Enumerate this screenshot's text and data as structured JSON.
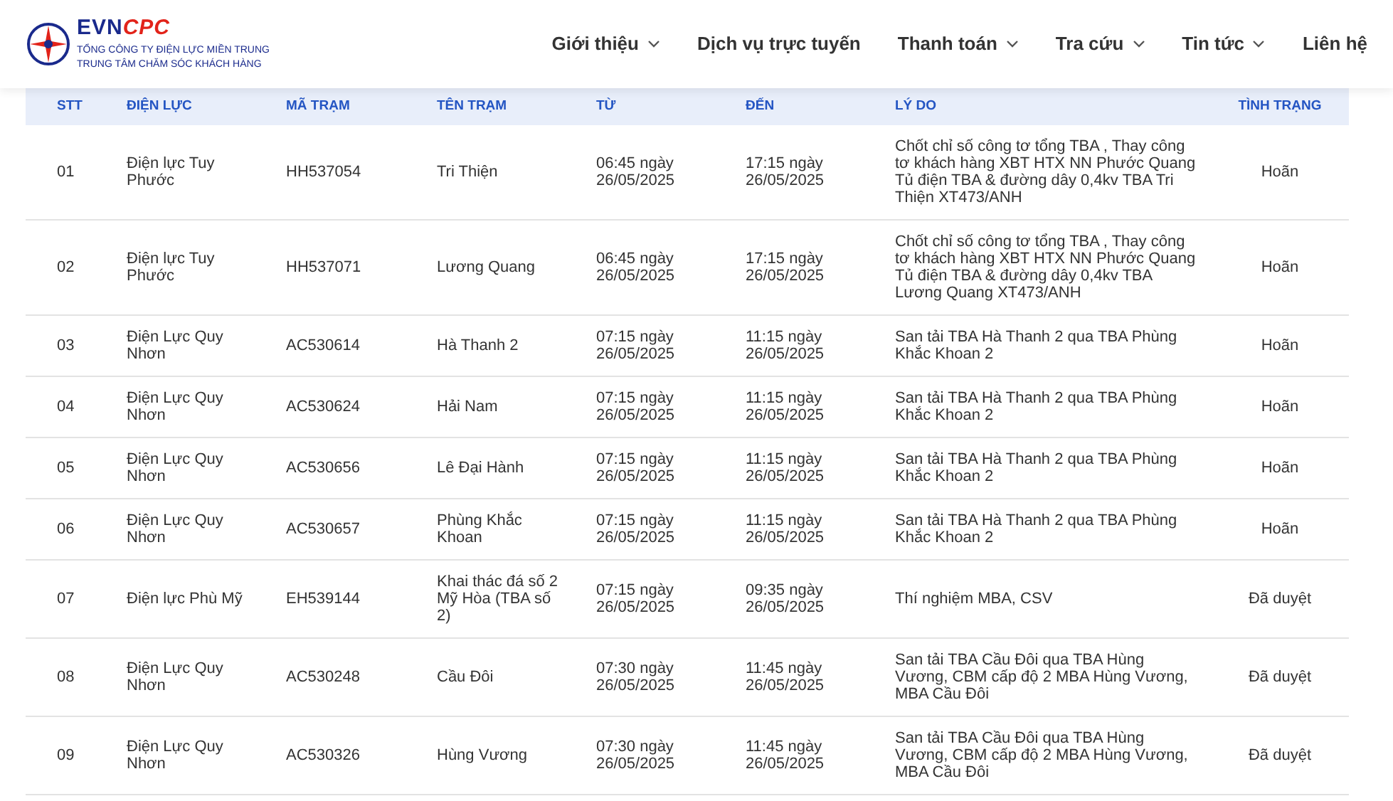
{
  "header": {
    "logo": {
      "brand": "EVN",
      "brand_accent": "CPC",
      "subtitle": [
        "TỔNG CÔNG TY ĐIỆN LỰC MIỀN TRUNG",
        "TRUNG TÂM CHĂM SÓC KHÁCH HÀNG"
      ]
    },
    "nav": [
      {
        "label": "Giới thiệu",
        "dropdown": true
      },
      {
        "label": "Dịch vụ trực tuyến",
        "dropdown": false
      },
      {
        "label": "Thanh toán",
        "dropdown": true
      },
      {
        "label": "Tra cứu",
        "dropdown": true
      },
      {
        "label": "Tin tức",
        "dropdown": true
      },
      {
        "label": "Liên hệ",
        "dropdown": false
      }
    ]
  },
  "table": {
    "columns": [
      "STT",
      "ĐIỆN LỰC",
      "MÃ TRẠM",
      "TÊN TRẠM",
      "TỪ",
      "ĐẾN",
      "LÝ DO",
      "TÌNH TRẠNG"
    ],
    "rows": [
      [
        "01",
        "Điện lực Tuy Phước",
        "HH537054",
        "Tri Thiện",
        "06:45 ngày 26/05/2025",
        "17:15 ngày 26/05/2025",
        "Chốt chỉ số công tơ tổng TBA , Thay công tơ khách hàng XBT HTX NN Phước Quang Tủ điện TBA & đường dây 0,4kv TBA Tri Thiện XT473/ANH",
        "Hoãn"
      ],
      [
        "02",
        "Điện lực Tuy Phước",
        "HH537071",
        "Lương Quang",
        "06:45 ngày 26/05/2025",
        "17:15 ngày 26/05/2025",
        "Chốt chỉ số công tơ tổng TBA , Thay công tơ khách hàng XBT HTX NN Phước Quang Tủ điện TBA & đường dây 0,4kv TBA Lương Quang XT473/ANH",
        "Hoãn"
      ],
      [
        "03",
        "Điện Lực Quy Nhơn",
        "AC530614",
        "Hà Thanh 2",
        "07:15 ngày 26/05/2025",
        "11:15 ngày 26/05/2025",
        "San tải TBA Hà Thanh 2 qua TBA Phùng Khắc Khoan 2",
        "Hoãn"
      ],
      [
        "04",
        "Điện Lực Quy Nhơn",
        "AC530624",
        "Hải Nam",
        "07:15 ngày 26/05/2025",
        "11:15 ngày 26/05/2025",
        "San tải TBA Hà Thanh 2 qua TBA Phùng Khắc Khoan 2",
        "Hoãn"
      ],
      [
        "05",
        "Điện Lực Quy Nhơn",
        "AC530656",
        "Lê Đại Hành",
        "07:15 ngày 26/05/2025",
        "11:15 ngày 26/05/2025",
        "San tải TBA Hà Thanh 2 qua TBA Phùng Khắc Khoan 2",
        "Hoãn"
      ],
      [
        "06",
        "Điện Lực Quy Nhơn",
        "AC530657",
        "Phùng Khắc Khoan",
        "07:15 ngày 26/05/2025",
        "11:15 ngày 26/05/2025",
        "San tải TBA Hà Thanh 2 qua TBA Phùng Khắc Khoan 2",
        "Hoãn"
      ],
      [
        "07",
        "Điện lực Phù Mỹ",
        "EH539144",
        "Khai thác đá số 2 Mỹ Hòa (TBA số 2)",
        "07:15 ngày 26/05/2025",
        "09:35 ngày 26/05/2025",
        "Thí nghiệm MBA, CSV",
        "Đã duyệt"
      ],
      [
        "08",
        "Điện Lực Quy Nhơn",
        "AC530248",
        "Cầu Đôi",
        "07:30 ngày 26/05/2025",
        "11:45 ngày 26/05/2025",
        "San tải TBA Cầu Đôi qua TBA Hùng Vương, CBM cấp độ 2 MBA Hùng Vương, MBA Cầu Đôi",
        "Đã duyệt"
      ],
      [
        "09",
        "Điện Lực Quy Nhơn",
        "AC530326",
        "Hùng Vương",
        "07:30 ngày 26/05/2025",
        "11:45 ngày 26/05/2025",
        "San tải TBA Cầu Đôi qua TBA Hùng Vương, CBM cấp độ 2 MBA Hùng Vương, MBA Cầu Đôi",
        "Đã duyệt"
      ]
    ]
  }
}
